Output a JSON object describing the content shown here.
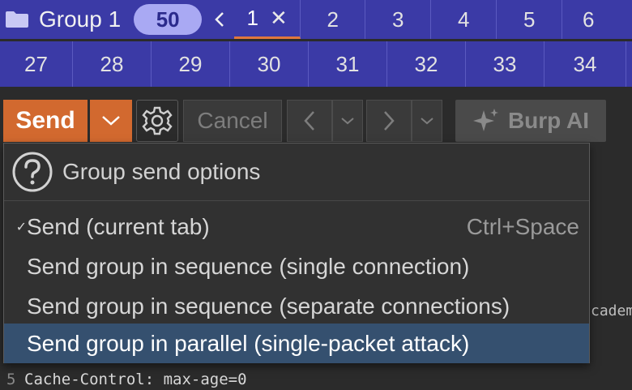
{
  "tabs": {
    "group_name": "Group 1",
    "group_count": "50",
    "row1": [
      "1",
      "2",
      "3",
      "4",
      "5",
      "6"
    ],
    "row2": [
      "27",
      "28",
      "29",
      "30",
      "31",
      "32",
      "33",
      "34"
    ]
  },
  "toolbar": {
    "send_label": "Send",
    "cancel_label": "Cancel",
    "burp_ai_label": "Burp AI"
  },
  "menu": {
    "title": "Group send options",
    "items": [
      {
        "label": "Send (current tab)",
        "shortcut": "Ctrl+Space",
        "checked": true
      },
      {
        "label": "Send group in sequence (single connection)"
      },
      {
        "label": "Send group in sequence (separate connections)"
      },
      {
        "label": "Send group in parallel (single-packet attack)"
      }
    ]
  },
  "editor": {
    "line_number": "5",
    "line_text": "Cache-Control: max-age=0",
    "right_peek": "cadem"
  },
  "colors": {
    "tab_bar": "#3b3aa6",
    "send_orange": "#d2692f",
    "highlight": "#35506f"
  }
}
